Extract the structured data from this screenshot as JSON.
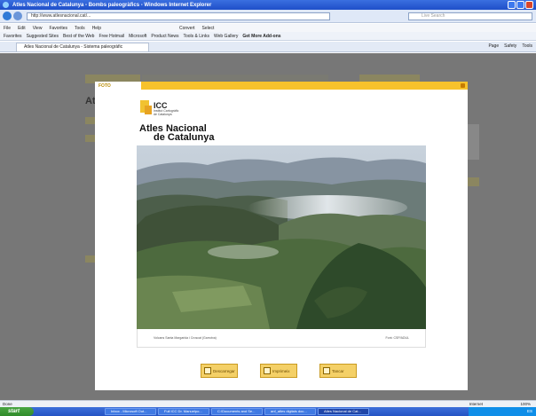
{
  "window": {
    "title": "Atles Nacional de Catalunya - Bombs paleogràfics - Windows Internet Explorer"
  },
  "addressbar": {
    "url": "http://www.atlesnacional.cat/...",
    "search_placeholder": "Live Search"
  },
  "menu": [
    "File",
    "Edit",
    "View",
    "Favorites",
    "Tools",
    "Help"
  ],
  "toolbar_extra": [
    "Convert",
    "Select"
  ],
  "favorites": {
    "label": "Favorites",
    "items": [
      "Suggested Sites",
      "Best of the Web",
      "Free Hotmail",
      "Microsoft",
      "Product News",
      "Tools & Links",
      "Web Gallery",
      "Get More Add-ons"
    ]
  },
  "tab": {
    "label": "Atles Nacional de Catalunya - Sistema paleogràfic"
  },
  "tab_tools": [
    "Page",
    "Safety",
    "Tools"
  ],
  "background": {
    "heading": "At"
  },
  "modal": {
    "tab_label": "FOTO",
    "logo_title": "ICC",
    "logo_subtitle_1": "Institut Cartogràfic",
    "logo_subtitle_2": "de Catalunya",
    "atlas_line1": "Atles Nacional",
    "atlas_line2": "de Catalunya",
    "caption_left": "Volcans Santa Margarida i Croscat (Garrotxa)",
    "caption_right": "Font: CSP/ADUL",
    "buttons": [
      {
        "label": "Descarregar"
      },
      {
        "label": "Imprimeix"
      },
      {
        "label": "Tancar"
      }
    ]
  },
  "statusbar": {
    "text": "Done",
    "zone": "Internet",
    "zoom": "100%"
  },
  "taskbar": {
    "start": "start",
    "tasks": [
      "Inbox - Microsoft Out...",
      "Full ICC Dr. Manuelpo...",
      "C:\\Documents and Se...",
      "anf_atles digitals doc...",
      "Atles Nacional de Cat..."
    ],
    "tray": "ES"
  },
  "colors": {
    "accent": "#f7c22c",
    "page_overlay": "#777777",
    "taskbar": "#2453c4"
  }
}
